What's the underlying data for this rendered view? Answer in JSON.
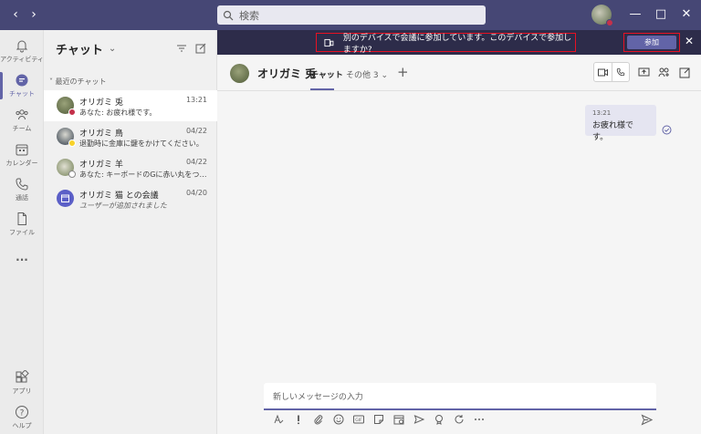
{
  "titlebar": {
    "search_placeholder": "検索",
    "back_icon": "chevron-left-icon",
    "forward_icon": "chevron-right-icon"
  },
  "rail": {
    "items": [
      {
        "label": "アクティビティ",
        "icon": "bell-icon"
      },
      {
        "label": "チャット",
        "icon": "chat-icon"
      },
      {
        "label": "チーム",
        "icon": "teams-icon"
      },
      {
        "label": "カレンダー",
        "icon": "calendar-icon"
      },
      {
        "label": "通話",
        "icon": "phone-icon"
      },
      {
        "label": "ファイル",
        "icon": "file-icon"
      },
      {
        "label": "...",
        "icon": "more-icon"
      },
      {
        "label": "アプリ",
        "icon": "apps-icon"
      },
      {
        "label": "ヘルプ",
        "icon": "help-icon"
      }
    ]
  },
  "list": {
    "title": "チャット",
    "section": "最近のチャット",
    "items": [
      {
        "name": "オリガミ 兎",
        "preview": "あなた: お疲れ様です。",
        "time": "13:21"
      },
      {
        "name": "オリガミ 鳥",
        "preview": "退勤時に金庫に鍵をかけてください。",
        "time": "04/22"
      },
      {
        "name": "オリガミ 羊",
        "preview": "あなた: キーボードのGに赤い丸をつけま...",
        "time": "04/22"
      },
      {
        "name": "オリガミ 猫 との会議",
        "preview": "ユーザーが追加されました",
        "time": "04/20"
      }
    ]
  },
  "banner": {
    "message": "別のデバイスで会議に参加しています。このデバイスで参加しますか?",
    "join_label": "参加",
    "close": "✕",
    "highlight_color": "#e81123"
  },
  "chat": {
    "name": "オリガミ 兎",
    "tab": "チャット",
    "more": "その他 3",
    "plus": "+",
    "message_time": "13:21",
    "message_text": "お疲れ様です。",
    "compose_placeholder": "新しいメッセージの入力"
  },
  "colors": {
    "accent": "#6264a7",
    "titlebar": "#464775",
    "banner": "#2d2c4a"
  }
}
